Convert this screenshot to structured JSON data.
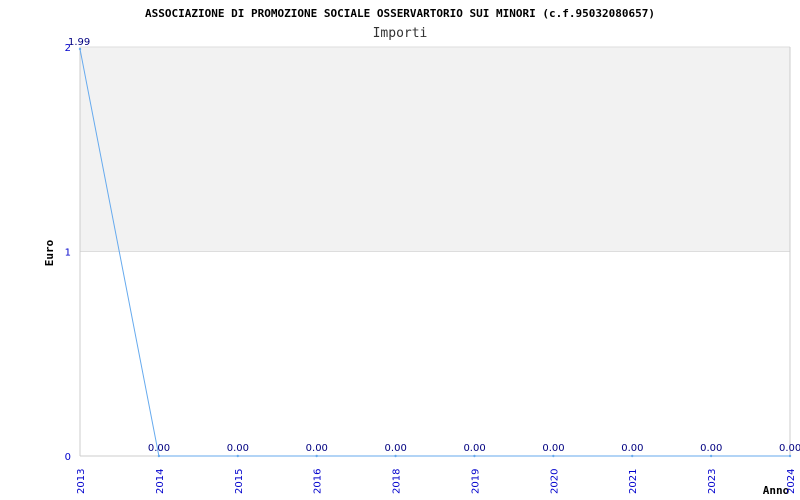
{
  "chart_data": {
    "type": "line",
    "title": "ASSOCIAZIONE DI PROMOZIONE SOCIALE OSSERVARTORIO SUI MINORI (c.f.95032080657)",
    "subtitle": "Importi",
    "xlabel": "Anno",
    "ylabel": "Euro",
    "categories": [
      "2013",
      "2014",
      "2015",
      "2016",
      "2018",
      "2019",
      "2020",
      "2021",
      "2023",
      "2024"
    ],
    "series": [
      {
        "values": [
          1.99,
          0,
          0,
          0,
          0,
          0,
          0,
          0,
          0,
          0
        ],
        "labels": [
          "1.99",
          "0.00",
          "0.00",
          "0.00",
          "0.00",
          "0.00",
          "0.00",
          "0.00",
          "0.00",
          "0.00"
        ],
        "color": "#66aaee"
      }
    ],
    "yticks": [
      "0",
      "1",
      "2"
    ],
    "ylim": [
      0,
      2
    ],
    "grid": true,
    "band_color": "#f2f2f2",
    "tick_color": "#0000cc",
    "label_color": "#000080"
  }
}
